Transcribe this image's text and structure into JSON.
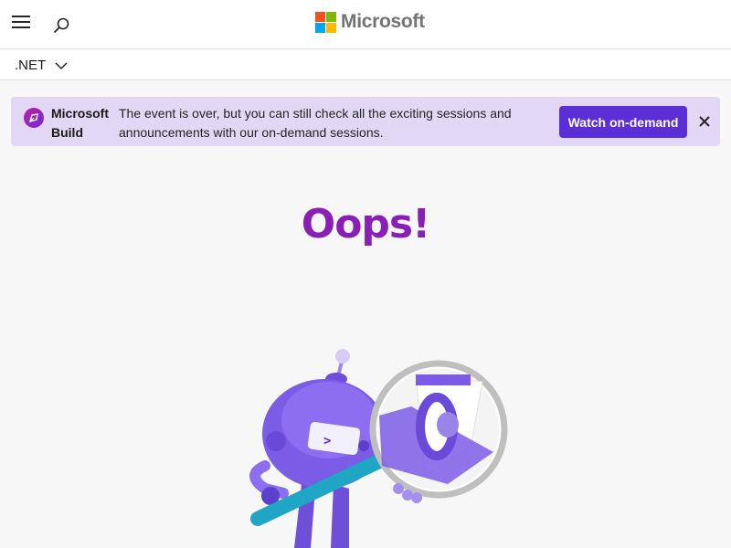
{
  "header": {
    "brand_name": "Microsoft",
    "logo_colors": [
      "#f25022",
      "#7fba00",
      "#00a4ef",
      "#ffb900"
    ],
    "menu_icon": "hamburger-menu-icon",
    "search_icon": "search-icon"
  },
  "subnav": {
    "product_label": ".NET",
    "dropdown_icon": "chevron-down-icon"
  },
  "banner": {
    "title": "Microsoft Build",
    "message": "The event is over, but you can still check all the exciting sessions and announcements with our on-demand sessions.",
    "cta_label": "Watch on-demand",
    "close_icon": "close-icon",
    "background_color": "#e2d7f5",
    "cta_color": "#5c2ed6"
  },
  "main": {
    "heading": "Oops!",
    "heading_color": "#8a1fb5",
    "illustration": "dotnet-bot-magnifying-glass"
  }
}
